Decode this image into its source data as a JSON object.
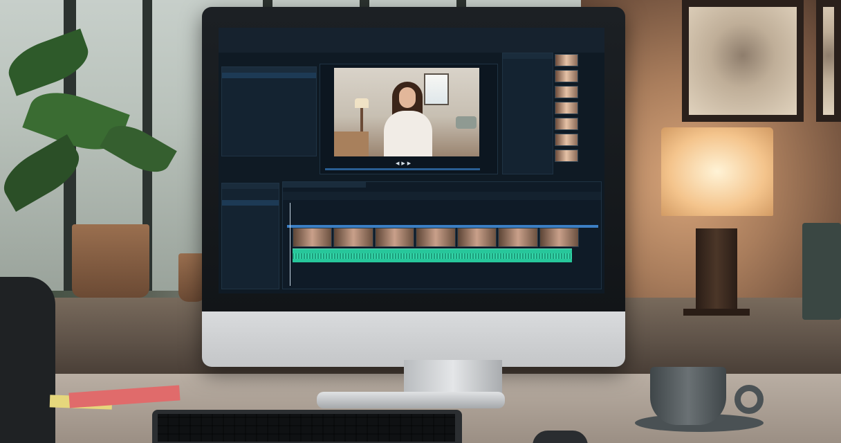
{
  "app": {
    "window_title": "",
    "menu": [],
    "timecode": "",
    "panels": {
      "media_bin_header": "",
      "effects_header": "",
      "timeline_tab": ""
    },
    "media_items": [
      "",
      "",
      "",
      "",
      "",
      "",
      "",
      "",
      "",
      "",
      "",
      ""
    ],
    "ruler_ticks": [
      "",
      "",
      "",
      "",
      "",
      "",
      "",
      "",
      "",
      "",
      "",
      "",
      "",
      "",
      "",
      "",
      "",
      ""
    ]
  },
  "icons": {
    "play": "play-icon",
    "back": "step-back-icon",
    "forward": "step-forward-icon"
  },
  "colors": {
    "ui_background": "#0f1a24",
    "timeline_video_track": "#3c7fc4",
    "timeline_audio_track": "#27c79b",
    "selection": "#1d3a55"
  }
}
